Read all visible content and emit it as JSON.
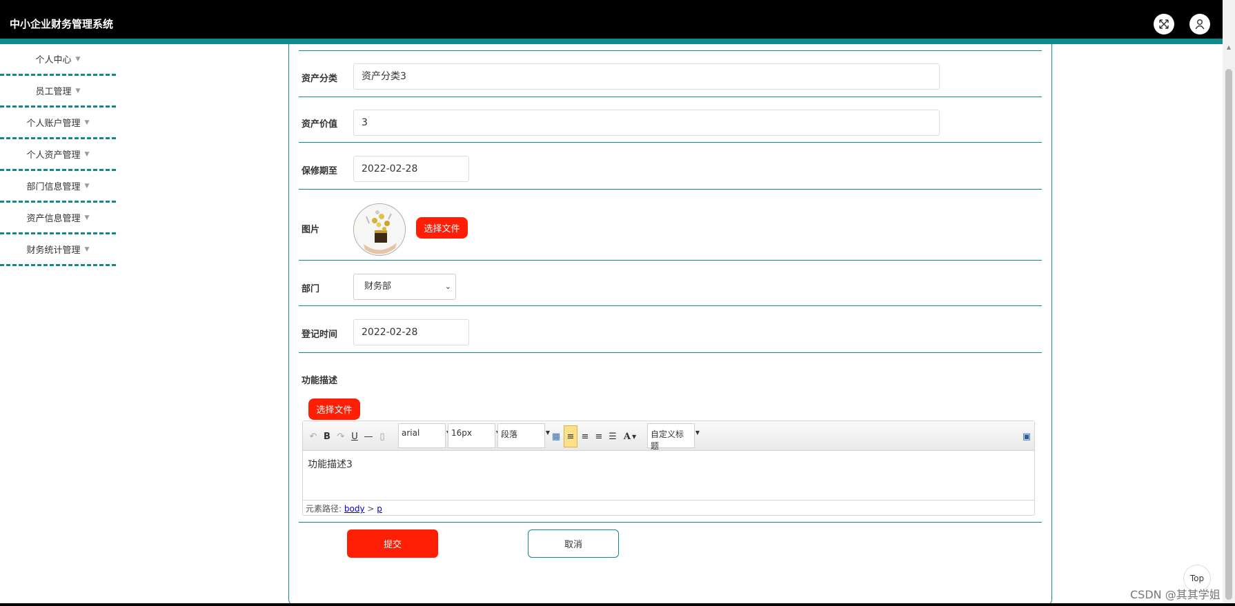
{
  "app": {
    "title": "中小企业财务管理系统"
  },
  "header": {
    "fullscreen_icon": "expand-icon",
    "user_icon": "user-icon"
  },
  "sidebar": {
    "items": [
      {
        "label": "个人中心"
      },
      {
        "label": "员工管理"
      },
      {
        "label": "个人账户管理"
      },
      {
        "label": "个人资产管理"
      },
      {
        "label": "部门信息管理"
      },
      {
        "label": "资产信息管理"
      },
      {
        "label": "财务统计管理"
      }
    ]
  },
  "form": {
    "category": {
      "label": "资产分类",
      "value": "资产分类3"
    },
    "value": {
      "label": "资产价值",
      "value": "3"
    },
    "warranty": {
      "label": "保修期至",
      "value": "2022-02-28"
    },
    "image": {
      "label": "图片",
      "button": "选择文件"
    },
    "department": {
      "label": "部门",
      "value": "财务部"
    },
    "register_time": {
      "label": "登记时间",
      "value": "2022-02-28"
    },
    "description": {
      "label": "功能描述",
      "button": "选择文件",
      "font_family": "arial",
      "font_size": "16px",
      "paragraph": "段落",
      "custom_title": "自定义标题",
      "content": "功能描述3",
      "path_label": "元素路径:",
      "path_body": "body",
      "path_sep": ">",
      "path_p": "p"
    },
    "submit": "提交",
    "cancel": "取消"
  },
  "top_button": "Top",
  "watermark": "CSDN @其其学姐",
  "colors": {
    "accent": "#0d8a89",
    "primary_button": "#ff1f06",
    "header": "#000000"
  }
}
